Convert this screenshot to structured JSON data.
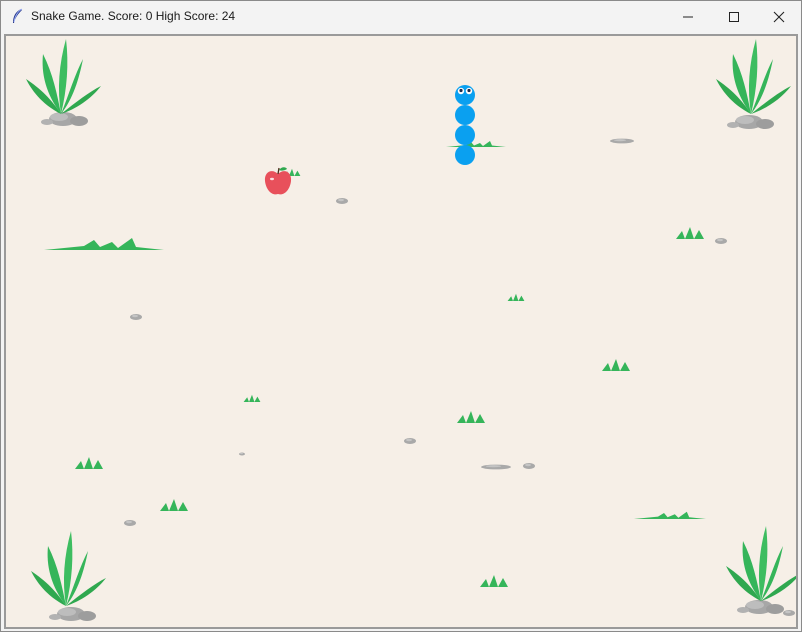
{
  "window": {
    "title": "Snake Game. Score: 0 High Score: 24",
    "controls": [
      "minimize",
      "maximize",
      "close"
    ]
  },
  "game": {
    "score": 0,
    "high_score": 24,
    "snake_segments": 4,
    "snake_direction": "up",
    "food": "apple",
    "colors": {
      "background": "#f6efe7",
      "snake": "#0aa0f0",
      "apple": "#e8505b",
      "grass": "#35b55a",
      "rock": "#a9a9a9"
    }
  }
}
